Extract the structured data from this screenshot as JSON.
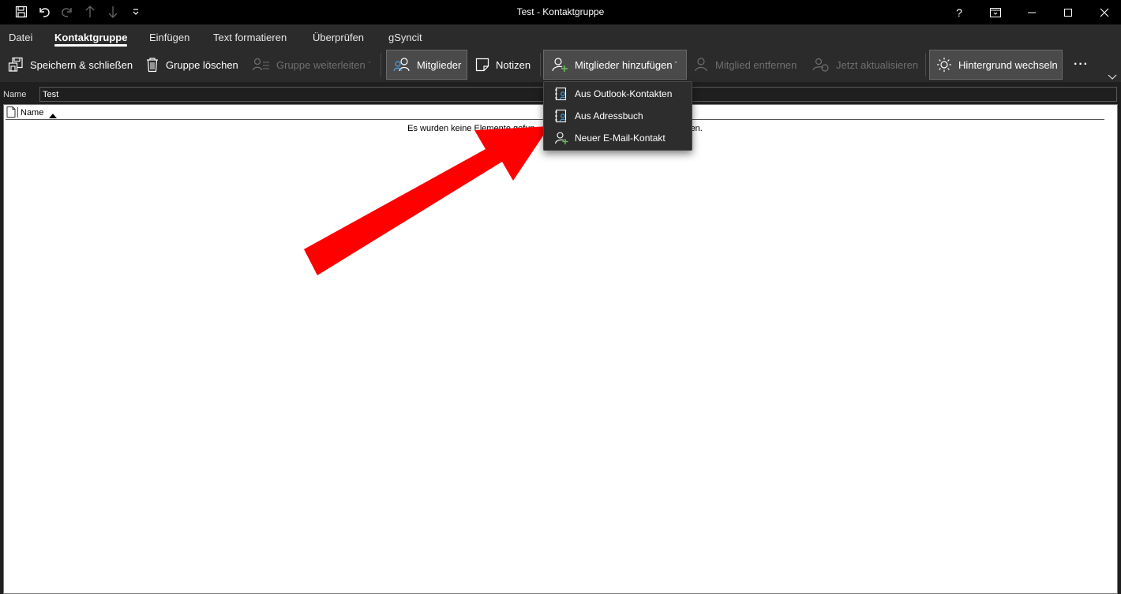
{
  "window": {
    "title": "Test  -  Kontaktgruppe",
    "help_label": "?"
  },
  "quick_access": {
    "icons": [
      "save-icon",
      "undo-icon",
      "redo-icon",
      "up-arrow-icon",
      "down-arrow-icon",
      "customize-icon"
    ]
  },
  "tabs": [
    {
      "label": "Datei"
    },
    {
      "label": "Kontaktgruppe"
    },
    {
      "label": "Einfügen"
    },
    {
      "label": "Text formatieren"
    },
    {
      "label": "Überprüfen"
    },
    {
      "label": "gSyncit"
    }
  ],
  "ribbon": {
    "save_close": "Speichern & schließen",
    "delete_group": "Gruppe löschen",
    "forward_group": "Gruppe weiterleiten",
    "members": "Mitglieder",
    "notes": "Notizen",
    "add_members": "Mitglieder hinzufügen",
    "remove_member": "Mitglied entfernen",
    "update_now": "Jetzt aktualisieren",
    "change_background": "Hintergrund wechseln",
    "more": "···"
  },
  "name_field": {
    "label": "Name",
    "value": "Test"
  },
  "list": {
    "column_name": "Name",
    "empty_message_left": "Es wurden keine Elemente gefun",
    "empty_message_right": "en."
  },
  "dropdown": {
    "items": [
      {
        "label": "Aus Outlook-Kontakten",
        "icon": "contact-book-icon"
      },
      {
        "label": "Aus Adressbuch",
        "icon": "address-book-icon"
      },
      {
        "label": "Neuer E-Mail-Kontakt",
        "icon": "add-person-icon"
      }
    ]
  },
  "colors": {
    "titlebar": "#000000",
    "ribbon": "#2b2b2b",
    "accent_green": "#6cbf5f",
    "annotation_arrow": "#ff0000"
  }
}
